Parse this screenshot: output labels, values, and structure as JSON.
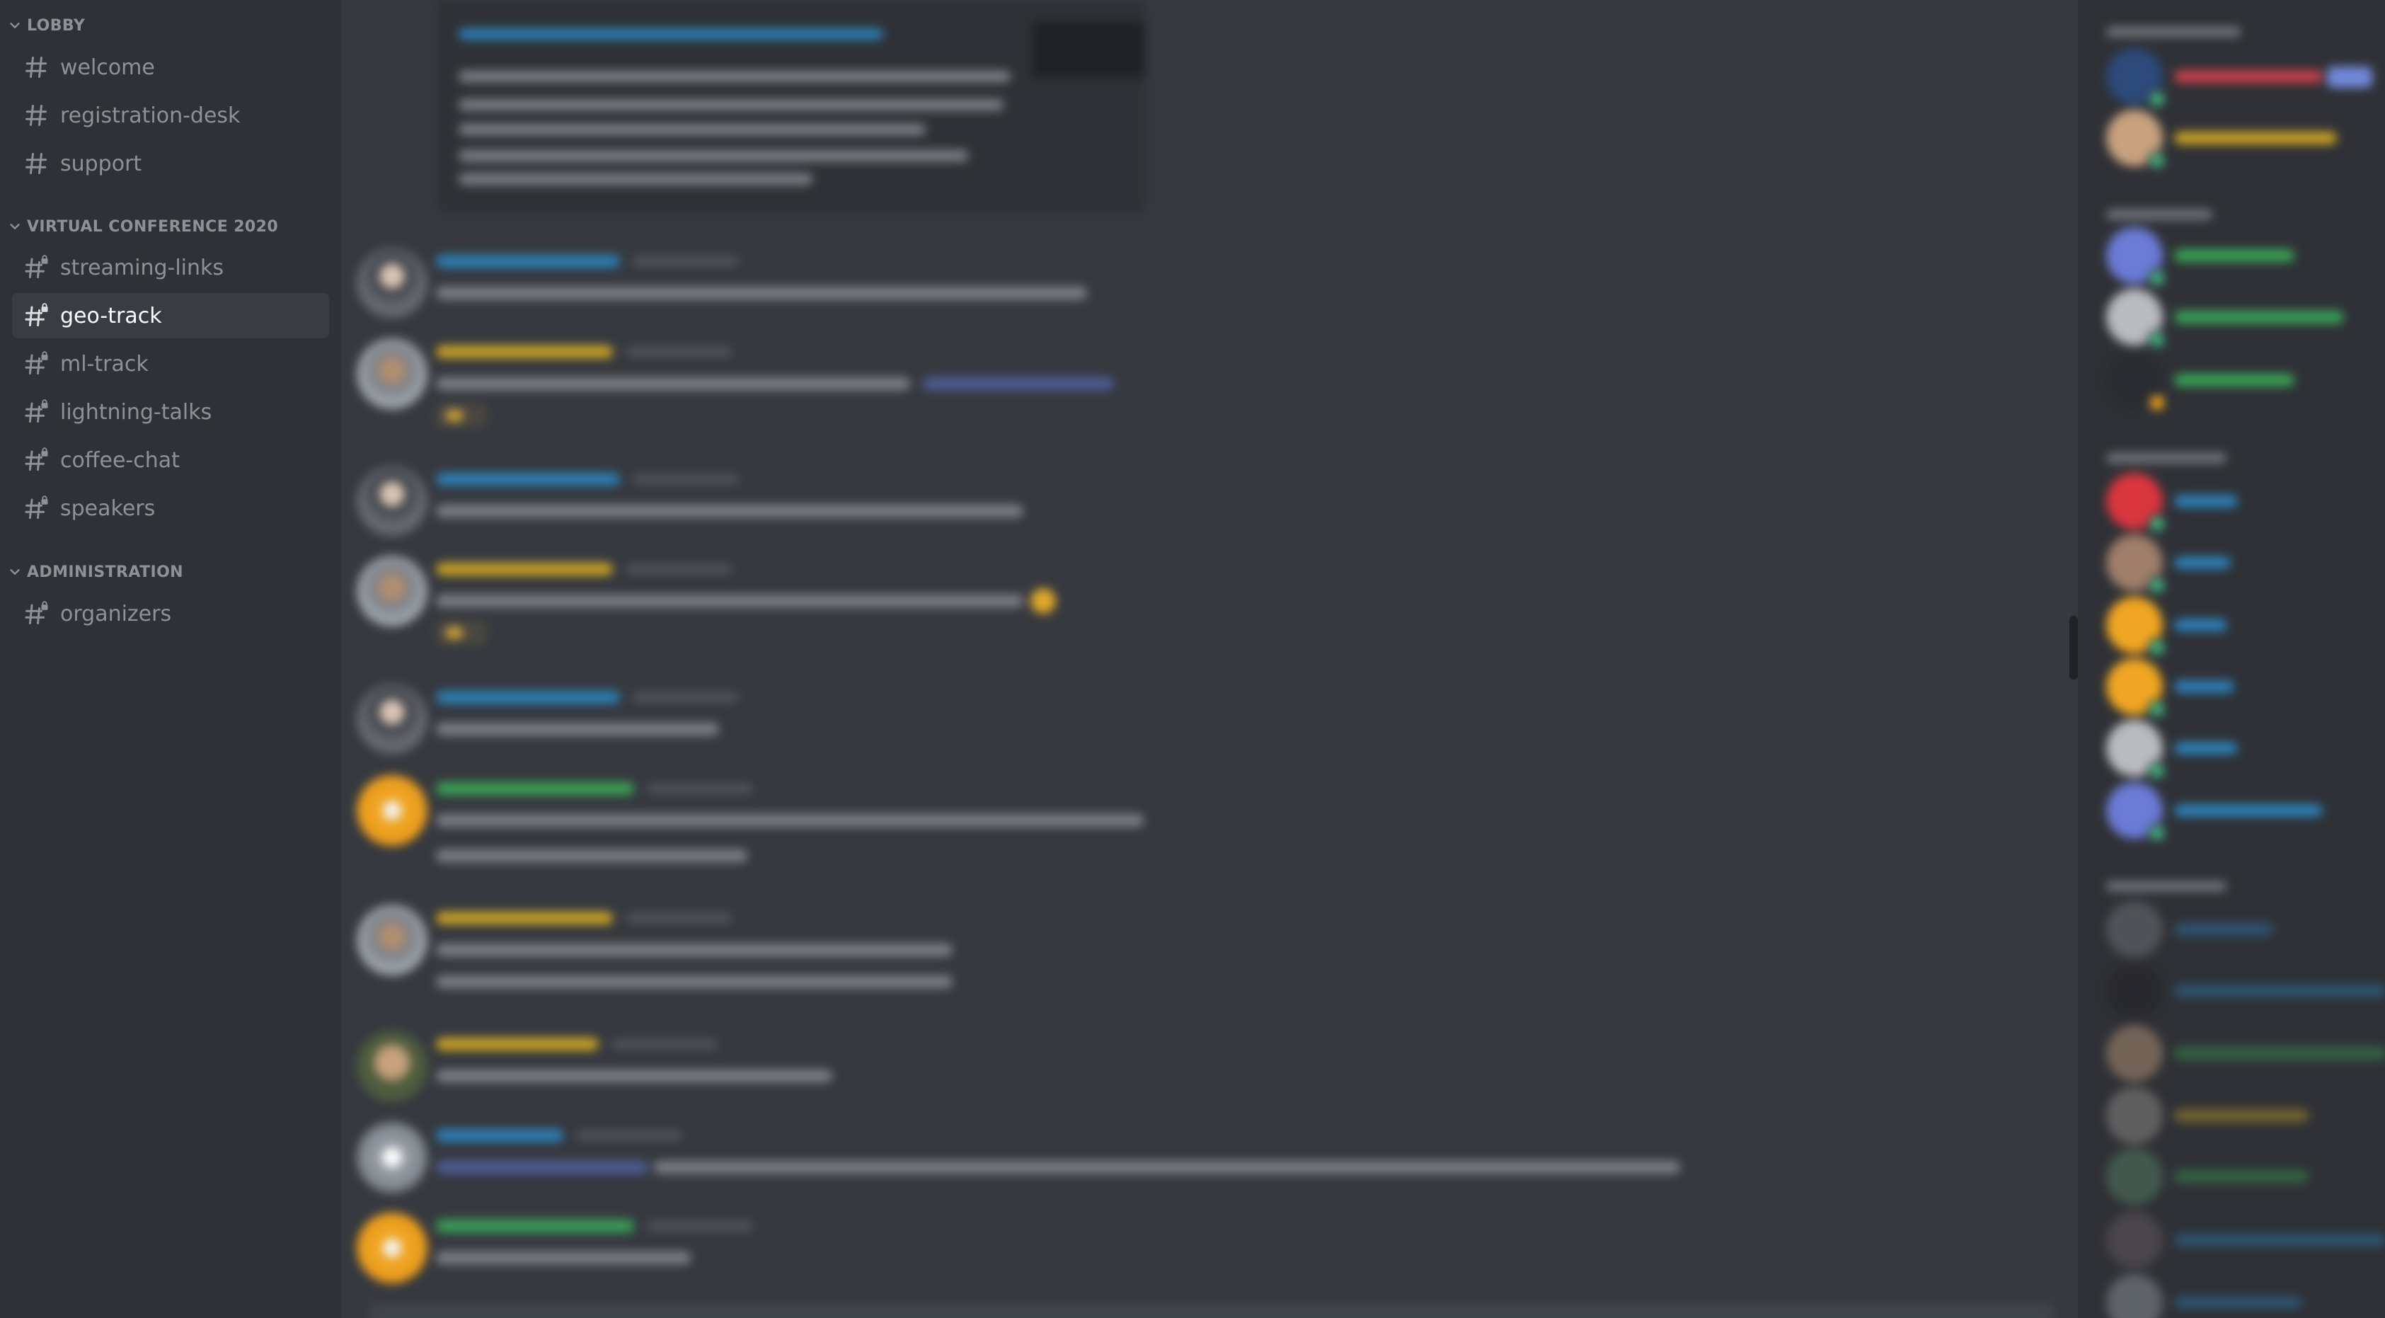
{
  "sidebar": {
    "categories": [
      {
        "name": "LOBBY",
        "channels": [
          {
            "name": "welcome",
            "locked": false
          },
          {
            "name": "registration-desk",
            "locked": false
          },
          {
            "name": "support",
            "locked": false
          }
        ]
      },
      {
        "name": "VIRTUAL CONFERENCE 2020",
        "channels": [
          {
            "name": "streaming-links",
            "locked": true
          },
          {
            "name": "geo-track",
            "locked": true,
            "active": true
          },
          {
            "name": "ml-track",
            "locked": true
          },
          {
            "name": "lightning-talks",
            "locked": true
          },
          {
            "name": "coffee-chat",
            "locked": true
          },
          {
            "name": "speakers",
            "locked": true
          }
        ]
      },
      {
        "name": "ADMINISTRATION",
        "channels": [
          {
            "name": "organizers",
            "locked": true
          }
        ]
      }
    ]
  },
  "colors": {
    "sidebar_bg": "#2f3136",
    "chat_bg": "#36393f",
    "active_channel_bg": "#393c43",
    "channel_text": "#8e9297",
    "active_text": "#ffffff",
    "online": "#43b581",
    "username_blue": "#2d7fb5",
    "username_yellow": "#c9a227",
    "username_green": "#3aa257"
  },
  "chat": {
    "content_state": "blurred"
  },
  "members": {
    "content_state": "blurred"
  }
}
